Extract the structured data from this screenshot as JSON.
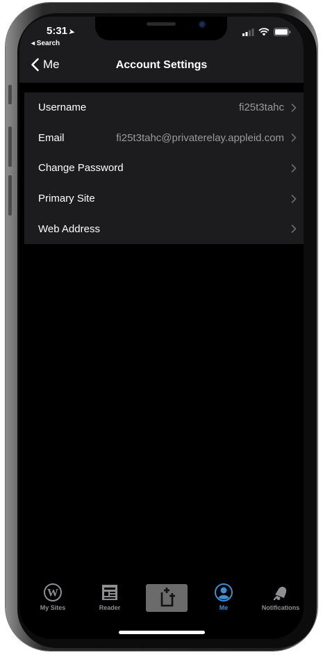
{
  "status_bar": {
    "time": "5:31",
    "back_app": "◂ Search"
  },
  "nav": {
    "back_label": "Me",
    "title": "Account Settings"
  },
  "settings": [
    {
      "label": "Username",
      "value": "fi25t3tahc"
    },
    {
      "label": "Email",
      "value": "fi25t3tahc@privaterelay.appleid.com"
    },
    {
      "label": "Change Password",
      "value": ""
    },
    {
      "label": "Primary Site",
      "value": ""
    },
    {
      "label": "Web Address",
      "value": ""
    }
  ],
  "tabs": [
    {
      "label": "My Sites",
      "icon": "wordpress-icon"
    },
    {
      "label": "Reader",
      "icon": "reader-icon"
    },
    {
      "label": "",
      "icon": "new-post-icon"
    },
    {
      "label": "Me",
      "icon": "me-icon",
      "active": true
    },
    {
      "label": "Notifications",
      "icon": "bell-icon"
    }
  ],
  "colors": {
    "accent": "#3a8fd6",
    "surface": "#1c1c1e",
    "background": "#000000",
    "secondary_text": "#9a9a9f"
  }
}
